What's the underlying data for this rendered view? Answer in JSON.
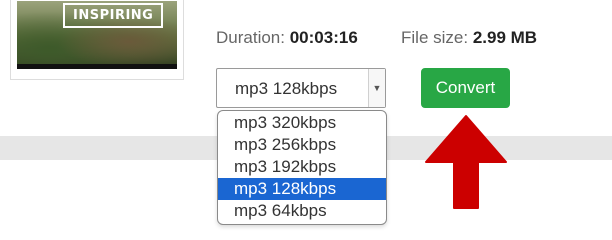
{
  "thumbnail": {
    "badge_text": "INSPIRING"
  },
  "meta": {
    "duration_label": "Duration:",
    "duration_value": "00:03:16",
    "filesize_label": "File size:",
    "filesize_value": "2.99 MB"
  },
  "format_select": {
    "selected": "mp3 128kbps",
    "options": [
      "mp3 320kbps",
      "mp3 256kbps",
      "mp3 192kbps",
      "mp3 128kbps",
      "mp3 64kbps"
    ],
    "highlighted_index": 3,
    "caret_icon": "chevron-down-icon"
  },
  "convert_button": {
    "label": "Convert",
    "color": "#28a745"
  },
  "annotation": {
    "arrow_icon": "red-up-arrow-icon",
    "color": "#cc0000"
  },
  "colors": {
    "highlight": "#1a66d2"
  }
}
